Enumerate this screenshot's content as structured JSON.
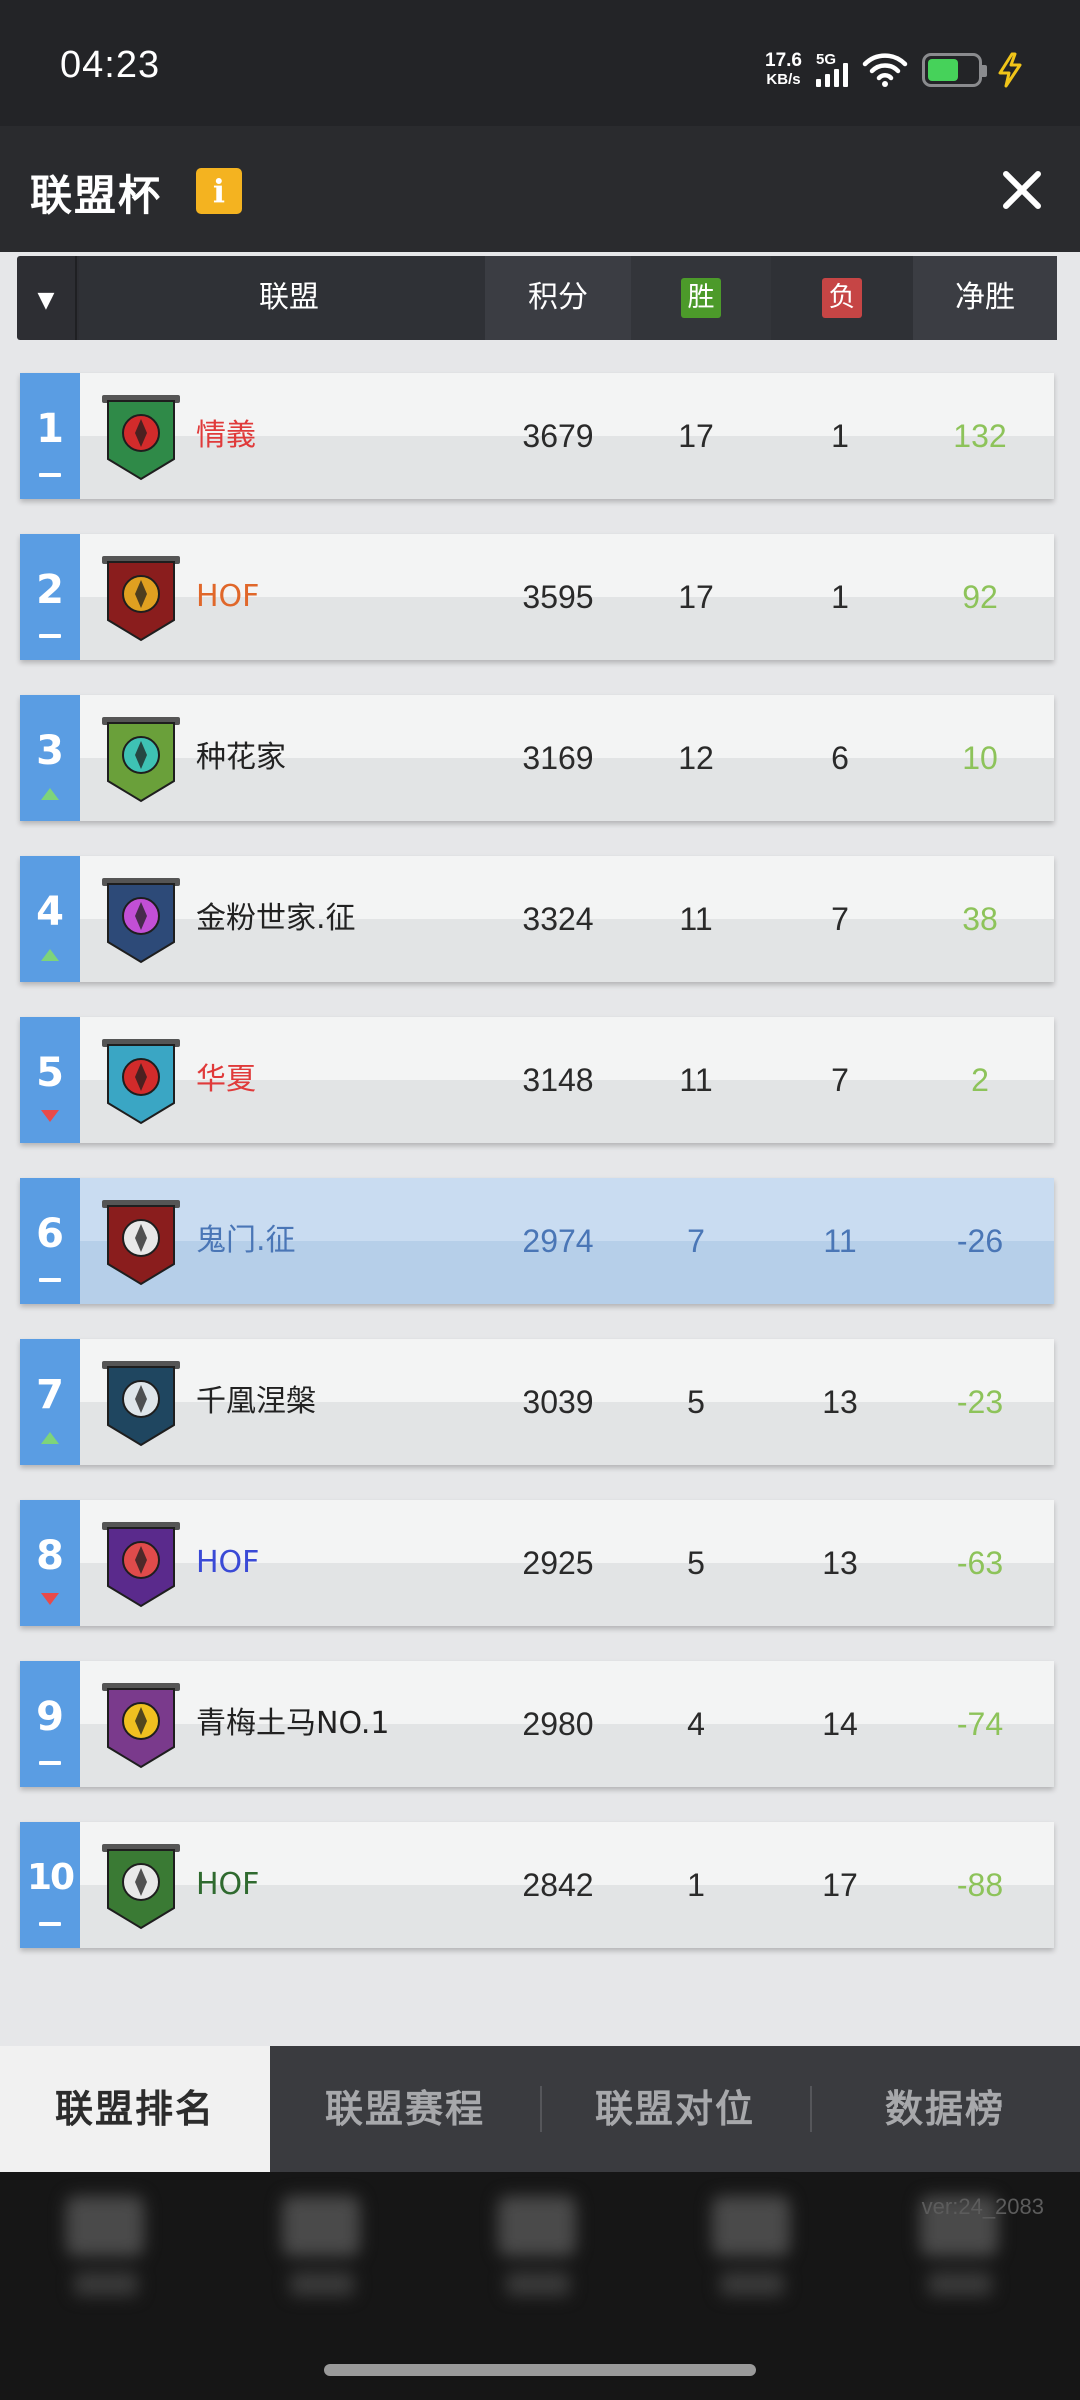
{
  "status_bar": {
    "time": "04:23",
    "net_speed_value": "17.6",
    "net_speed_unit": "KB/s",
    "network": "5G",
    "battery_color": "#46d25a",
    "charging_icon": "bolt-icon"
  },
  "header": {
    "title": "联盟杯",
    "info_icon": "i",
    "close_icon": "close-icon"
  },
  "columns": {
    "sort_icon": "▼",
    "alliance": "联盟",
    "points": "积分",
    "win": "胜",
    "loss": "负",
    "net": "净胜"
  },
  "rows": [
    {
      "rank": "1",
      "trend": "same",
      "name": "情義",
      "name_color": "#e03a3a",
      "emblem_color": "#2f8a48",
      "emblem_accent": "#d22b2b",
      "points": "3679",
      "win": "17",
      "loss": "1",
      "net": "132"
    },
    {
      "rank": "2",
      "trend": "same",
      "name": "HOF",
      "name_color": "#e0672a",
      "emblem_color": "#8a1d1d",
      "emblem_accent": "#e0a020",
      "points": "3595",
      "win": "17",
      "loss": "1",
      "net": "92"
    },
    {
      "rank": "3",
      "trend": "up",
      "name": "种花家",
      "name_color": "#222222",
      "emblem_color": "#6aa03a",
      "emblem_accent": "#3ec2b4",
      "points": "3169",
      "win": "12",
      "loss": "6",
      "net": "10"
    },
    {
      "rank": "4",
      "trend": "up",
      "name": "金粉世家.征",
      "name_color": "#222222",
      "emblem_color": "#2d4a78",
      "emblem_accent": "#c24fd6",
      "points": "3324",
      "win": "11",
      "loss": "7",
      "net": "38"
    },
    {
      "rank": "5",
      "trend": "down",
      "name": "华夏",
      "name_color": "#e03a3a",
      "emblem_color": "#3aa6c4",
      "emblem_accent": "#d22b2b",
      "points": "3148",
      "win": "11",
      "loss": "7",
      "net": "2"
    },
    {
      "rank": "6",
      "trend": "same",
      "name": "鬼门.征",
      "name_color": "#4a76b6",
      "emblem_color": "#8a1d1d",
      "emblem_accent": "#e8e8e8",
      "points": "2974",
      "win": "7",
      "loss": "11",
      "net": "-26",
      "self": true
    },
    {
      "rank": "7",
      "trend": "up",
      "name": "千凰涅槃",
      "name_color": "#222222",
      "emblem_color": "#1f4660",
      "emblem_accent": "#dfe6ea",
      "points": "3039",
      "win": "5",
      "loss": "13",
      "net": "-23"
    },
    {
      "rank": "8",
      "trend": "down",
      "name": "HOF",
      "name_color": "#3a4ad6",
      "emblem_color": "#5a2a8c",
      "emblem_accent": "#e04b4b",
      "points": "2925",
      "win": "5",
      "loss": "13",
      "net": "-63"
    },
    {
      "rank": "9",
      "trend": "same",
      "name": "青梅土马NO.1",
      "name_color": "#222222",
      "emblem_color": "#7a3a8c",
      "emblem_accent": "#f0c020",
      "points": "2980",
      "win": "4",
      "loss": "14",
      "net": "-74"
    },
    {
      "rank": "10",
      "trend": "same",
      "name": "HOF",
      "name_color": "#2f6a2f",
      "emblem_color": "#3a7a34",
      "emblem_accent": "#e8e8e8",
      "points": "2842",
      "win": "1",
      "loss": "17",
      "net": "-88"
    }
  ],
  "tabs": [
    {
      "label": "联盟排名",
      "active": true
    },
    {
      "label": "联盟赛程",
      "active": false
    },
    {
      "label": "联盟对位",
      "active": false
    },
    {
      "label": "数据榜",
      "active": false
    }
  ],
  "version": "ver:24_2083"
}
